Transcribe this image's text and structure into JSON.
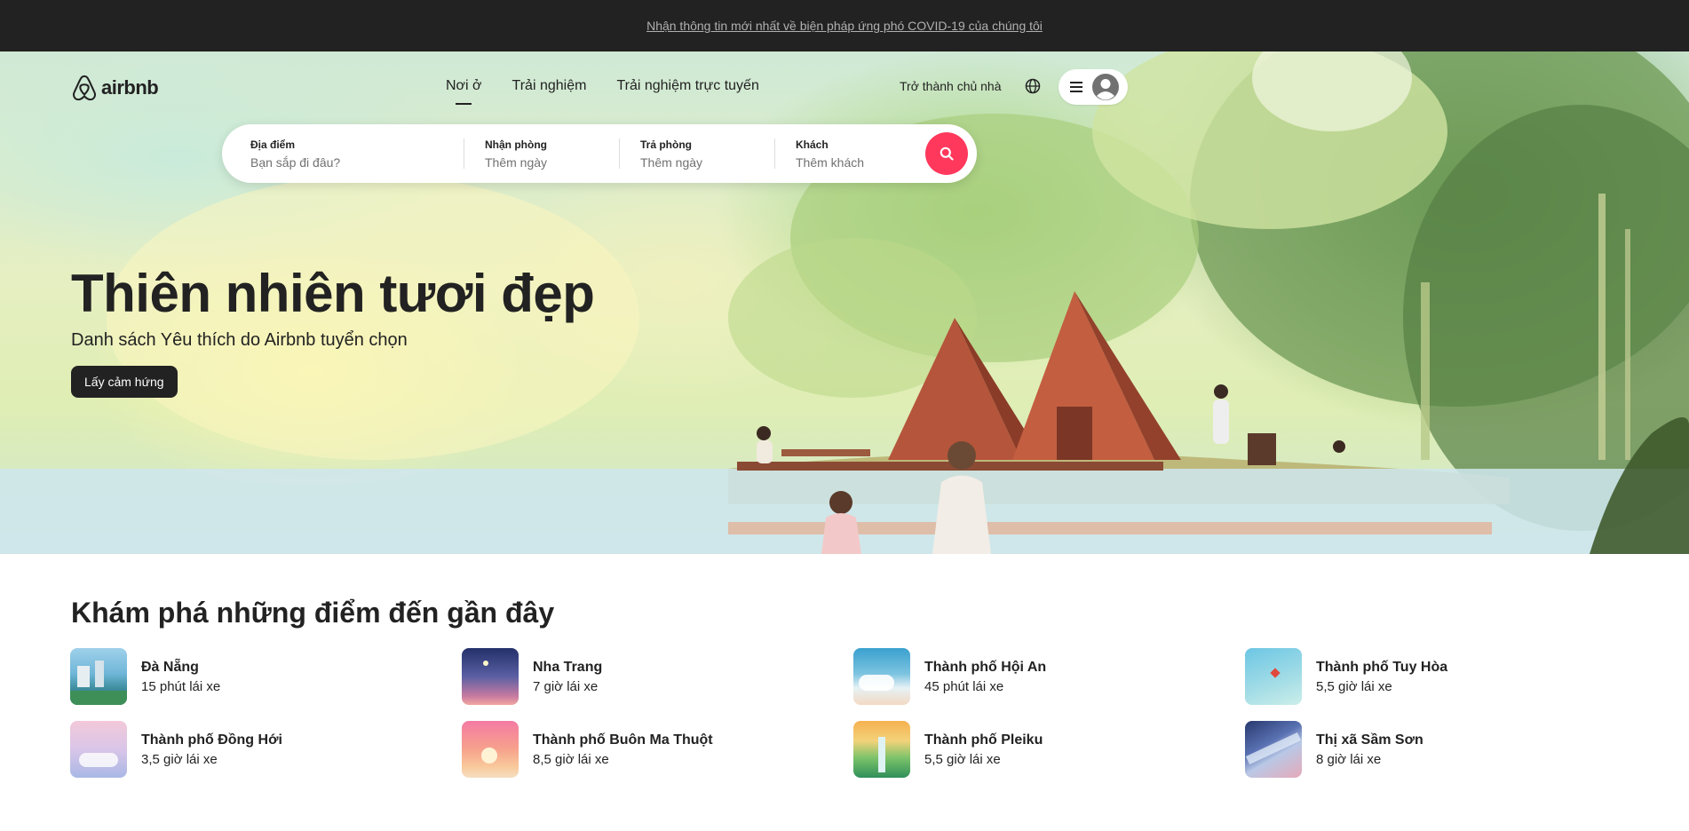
{
  "banner": {
    "text": "Nhận thông tin mới nhất về biện pháp ứng phó COVID-19 của chúng tôi"
  },
  "header": {
    "logo_text": "airbnb",
    "nav": [
      {
        "label": "Nơi ở",
        "active": true
      },
      {
        "label": "Trải nghiệm",
        "active": false
      },
      {
        "label": "Trải nghiệm trực tuyến",
        "active": false
      }
    ],
    "host_label": "Trở thành chủ nhà",
    "globe_icon": "globe-icon",
    "menu_icon": "hamburger-icon",
    "avatar_icon": "user-avatar-icon"
  },
  "search": {
    "location": {
      "label": "Địa điểm",
      "placeholder": "Bạn sắp đi đâu?"
    },
    "checkin": {
      "label": "Nhận phòng",
      "placeholder": "Thêm ngày"
    },
    "checkout": {
      "label": "Trả phòng",
      "placeholder": "Thêm ngày"
    },
    "guests": {
      "label": "Khách",
      "placeholder": "Thêm khách"
    },
    "button_icon": "search-icon",
    "accent": "#ff385c"
  },
  "hero": {
    "title": "Thiên nhiên tươi đẹp",
    "subtitle": "Danh sách Yêu thích do Airbnb tuyển chọn",
    "button": "Lấy cảm hứng"
  },
  "explore": {
    "title": "Khám phá những điểm đến gần đây",
    "destinations": [
      {
        "name": "Đà Nẵng",
        "time": "15 phút lái xe"
      },
      {
        "name": "Nha Trang",
        "time": "7 giờ lái xe"
      },
      {
        "name": "Thành phố Hội An",
        "time": "45 phút lái xe"
      },
      {
        "name": "Thành phố Tuy Hòa",
        "time": "5,5 giờ lái xe"
      },
      {
        "name": "Thành phố Đồng Hới",
        "time": "3,5 giờ lái xe"
      },
      {
        "name": "Thành phố Buôn Ma Thuột",
        "time": "8,5 giờ lái xe"
      },
      {
        "name": "Thành phố Pleiku",
        "time": "5,5 giờ lái xe"
      },
      {
        "name": "Thị xã Sầm Sơn",
        "time": "8 giờ lái xe"
      }
    ]
  }
}
